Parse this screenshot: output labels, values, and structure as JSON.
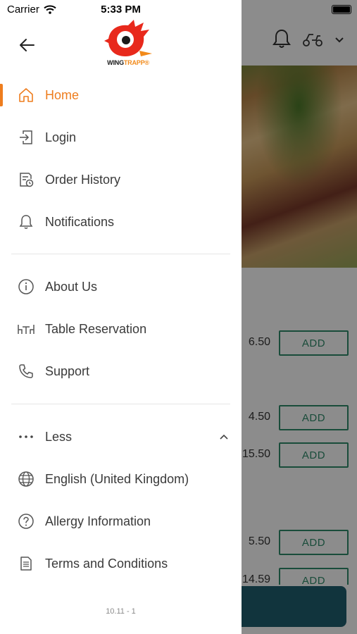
{
  "status_bar": {
    "carrier": "Carrier",
    "time": "5:33 PM"
  },
  "logo": {
    "text_part1": "WING",
    "text_part2": "TRAPP",
    "trademark": "®"
  },
  "menu_primary": [
    {
      "label": "Home",
      "icon": "home-icon",
      "active": true
    },
    {
      "label": "Login",
      "icon": "login-icon"
    },
    {
      "label": "Order History",
      "icon": "order-history-icon"
    },
    {
      "label": "Notifications",
      "icon": "bell-icon"
    }
  ],
  "menu_secondary": [
    {
      "label": "About Us",
      "icon": "info-icon"
    },
    {
      "label": "Table Reservation",
      "icon": "table-icon"
    },
    {
      "label": "Support",
      "icon": "phone-icon"
    }
  ],
  "menu_more": {
    "label": "Less",
    "icon": "dots-icon",
    "expanded": true
  },
  "menu_tertiary": [
    {
      "label": "English (United Kingdom)",
      "icon": "globe-icon"
    },
    {
      "label": "Allergy Information",
      "icon": "question-icon"
    },
    {
      "label": "Terms and Conditions",
      "icon": "document-icon"
    }
  ],
  "version": "10.11 - 1",
  "background": {
    "items": [
      {
        "price": "6.50",
        "button": "ADD"
      },
      {
        "price": "4.50",
        "button": "ADD"
      },
      {
        "price": "15.50",
        "button": "ADD"
      },
      {
        "price": "5.50",
        "button": "ADD"
      },
      {
        "price": "14.59",
        "button": "ADD"
      }
    ]
  },
  "colors": {
    "accent": "#ee7d1e",
    "text": "#3a3a3a",
    "add_button": "#2f8a6a",
    "bottom_bar": "#1f5f70"
  }
}
